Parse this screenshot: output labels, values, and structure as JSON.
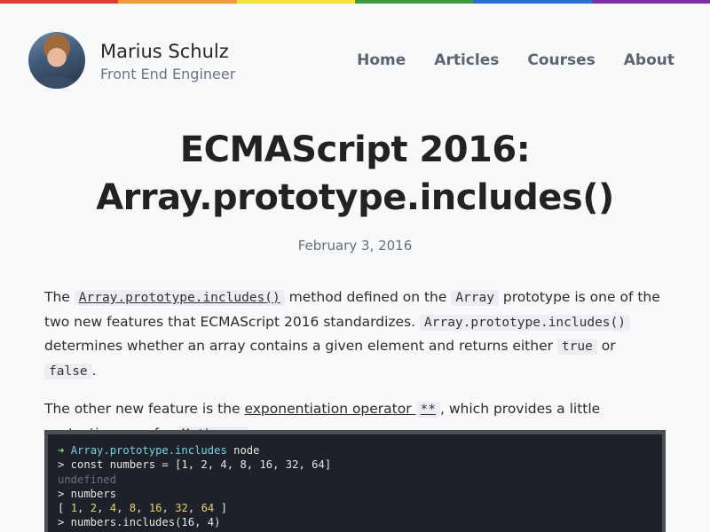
{
  "colors": {
    "rainbow": [
      "#e23b32",
      "#f29a35",
      "#f5e33b",
      "#3e9a3a",
      "#2a6fd8",
      "#7a2fa8"
    ],
    "background": "#f8f9fb"
  },
  "header": {
    "name": "Marius Schulz",
    "subtitle": "Front End Engineer",
    "avatar_alt": "Marius Schulz avatar",
    "nav": [
      "Home",
      "Articles",
      "Courses",
      "About"
    ]
  },
  "article": {
    "title_line1": "ECMAScript 2016:",
    "title_line2": "Array.prototype.includes()",
    "date": "February 3, 2016",
    "p1": {
      "t1": "The ",
      "c1": "Array.prototype.includes()",
      "t2": " method defined on the ",
      "c2": "Array",
      "t3": " prototype is one of the two new features that ECMAScript 2016 standardizes. ",
      "c3": "Array.prototype.includes()",
      "t4": " determines whether an array contains a given element and returns either ",
      "c4": "true",
      "t5": " or ",
      "c5": "false",
      "t6": "."
    },
    "p2": {
      "t1": "The other new feature is the ",
      "link": "exponentiation operator",
      "space": " ",
      "c1": "**",
      "t2": ", which provides a little syntactic sugar for ",
      "c2": "Math.pow",
      "t3": "."
    }
  },
  "terminal": {
    "arrow": "➜",
    "dir": "Array.prototype.includes",
    "cmd": " node",
    "l2": "> const numbers = [1, 2, 4, 8, 16, 32, 64]",
    "l3": "undefined",
    "l4": "> numbers",
    "l5_open": "[ ",
    "l5_nums": [
      "1",
      "2",
      "4",
      "8",
      "16",
      "32",
      "64"
    ],
    "l5_close": " ]",
    "l6": "> numbers.includes(16, 4)"
  }
}
